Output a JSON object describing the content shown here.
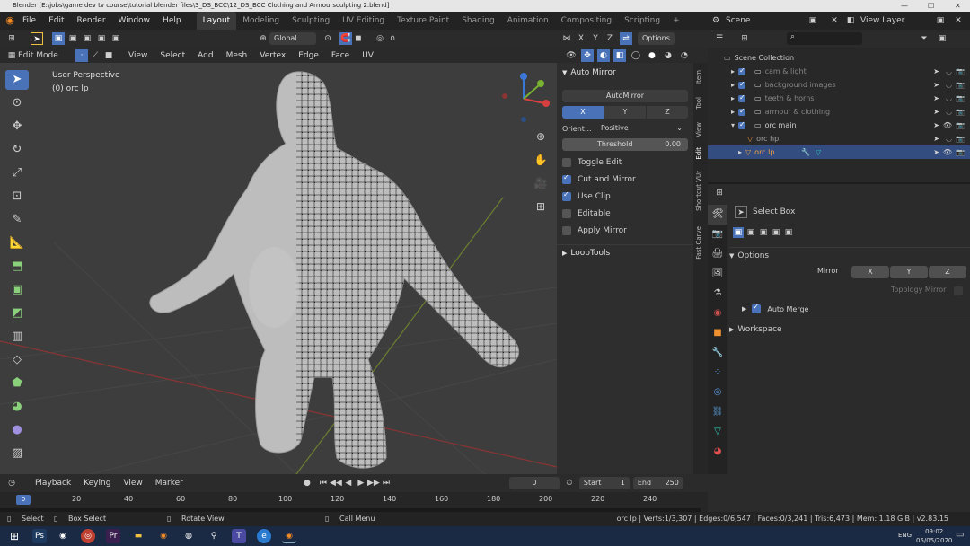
{
  "window": {
    "title": "Blender [E:\\jobs\\game dev tv course\\tutorial blender files\\3_DS_BCC\\12_DS_BCC Clothing and Armoursculpting 2.blend]",
    "minimize": "—",
    "maximize": "☐",
    "close": "✕"
  },
  "menus": [
    "File",
    "Edit",
    "Render",
    "Window",
    "Help"
  ],
  "workspaces": [
    "Layout",
    "Modeling",
    "Sculpting",
    "UV Editing",
    "Texture Paint",
    "Shading",
    "Animation",
    "Rendering",
    "Compositing",
    "Scripting"
  ],
  "workspace_add": "+",
  "scene": {
    "label": "Scene",
    "view_layer": "View Layer"
  },
  "tool_header": {
    "orientation": "Global",
    "options": "Options",
    "axes": [
      "X",
      "Y",
      "Z"
    ]
  },
  "viewport_header": {
    "mode": "Edit Mode",
    "menus": [
      "View",
      "Select",
      "Add",
      "Mesh",
      "Vertex",
      "Edge",
      "Face",
      "UV"
    ]
  },
  "viewport": {
    "perspective": "User Perspective",
    "object": "(0) orc lp"
  },
  "npanel": {
    "title": "Auto Mirror",
    "automirror_button": "AutoMirror",
    "axes": [
      "X",
      "Y",
      "Z"
    ],
    "orientation_label": "Orient...",
    "orientation_value": "Positive",
    "threshold_label": "Threshold",
    "threshold_value": "0.00",
    "options": [
      {
        "label": "Toggle Edit",
        "checked": false
      },
      {
        "label": "Cut and Mirror",
        "checked": true
      },
      {
        "label": "Use Clip",
        "checked": true
      },
      {
        "label": "Editable",
        "checked": false
      },
      {
        "label": "Apply Mirror",
        "checked": false
      }
    ],
    "looptools": "LoopTools",
    "tabs": [
      "Item",
      "Tool",
      "View",
      "Edit",
      "Shortcut VUr",
      "Fast Carve"
    ]
  },
  "outliner": {
    "title": "Scene Collection",
    "items": [
      {
        "label": "cam & light",
        "selected": false
      },
      {
        "label": "background images",
        "selected": false
      },
      {
        "label": "teeth & horns",
        "selected": false
      },
      {
        "label": "armour & clothing",
        "selected": false
      },
      {
        "label": "orc main",
        "selected": false
      },
      {
        "label": "orc hp",
        "selected": false
      },
      {
        "label": "orc lp",
        "selected": true
      }
    ]
  },
  "properties": {
    "tool_name": "Select Box",
    "options_label": "Options",
    "mirror_label": "Mirror",
    "mirror_axes": [
      "X",
      "Y",
      "Z"
    ],
    "topology_mirror": "Topology Mirror",
    "auto_merge": "Auto Merge",
    "workspace": "Workspace"
  },
  "timeline": {
    "menus": [
      "Playback",
      "Keying",
      "View",
      "Marker"
    ],
    "current_frame": "0",
    "start_label": "Start",
    "start_value": "1",
    "end_label": "End",
    "end_value": "250",
    "ruler": [
      "0",
      "20",
      "40",
      "60",
      "80",
      "100",
      "120",
      "140",
      "160",
      "180",
      "200",
      "220",
      "240"
    ]
  },
  "statusbar": {
    "select": "Select",
    "box_select": "Box Select",
    "rotate_view": "Rotate View",
    "call_menu": "Call Menu",
    "stats": "orc lp | Verts:1/3,307 | Edges:0/6,547 | Faces:0/3,241 | Tris:6,473 | Mem: 1.18 GiB | v2.83.15"
  },
  "taskbar": {
    "time": "09:02",
    "date": "05/05/2020",
    "lang": "ENG"
  },
  "colors": {
    "accent": "#4a72b8",
    "viewport_bg": "#3d3d3d",
    "panel_bg": "#2e2e2e",
    "selected_row": "#334d80"
  }
}
